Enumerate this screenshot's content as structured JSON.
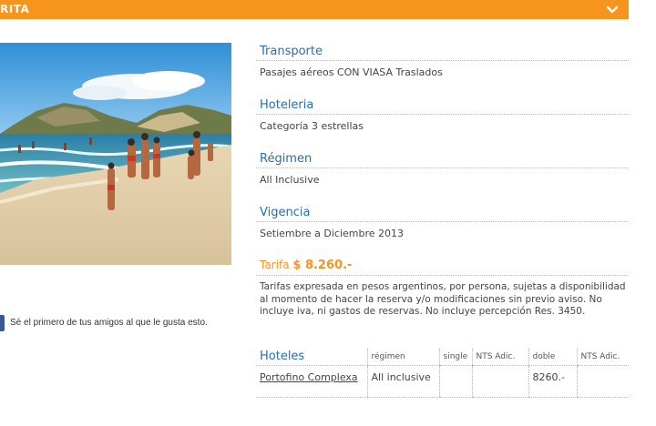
{
  "header": {
    "title": "RITA",
    "chevron_icon": "chevron-down-icon"
  },
  "facebook": {
    "like_text": "Sé el primero de tus amigos al que le gusta esto."
  },
  "colors": {
    "accent": "#f7941d",
    "title_blue": "#2a6fa8",
    "facebook": "#3b5998"
  },
  "sections": [
    {
      "title": "Transporte",
      "body": "Pasajes aéreos CON VIASA Traslados"
    },
    {
      "title": "Hoteleria",
      "body": "Categoría 3 estrellas"
    },
    {
      "title": "Régimen",
      "body": "All Inclusive"
    },
    {
      "title": "Vigencia",
      "body": "Setiembre a Diciembre 2013"
    }
  ],
  "tarifa": {
    "label": "Tarifa",
    "price": "$ 8.260.-",
    "disclaimer": "Tarifas expresada en pesos argentinos, por persona, sujetas a disponibilidad al momento de hacer la reserva y/o modificaciones sin previo aviso. No incluye iva, ni gastos de reservas. No incluye percepción Res. 3450."
  },
  "hotels": {
    "headers": [
      "Hoteles",
      "régimen",
      "single",
      "NTS Adic.",
      "doble",
      "NTS Adic."
    ],
    "rows": [
      {
        "name": "Portofino Complexa",
        "regimen": "All inclusive",
        "single": "",
        "nts1": "",
        "doble": "8260.-",
        "nts2": ""
      }
    ]
  }
}
